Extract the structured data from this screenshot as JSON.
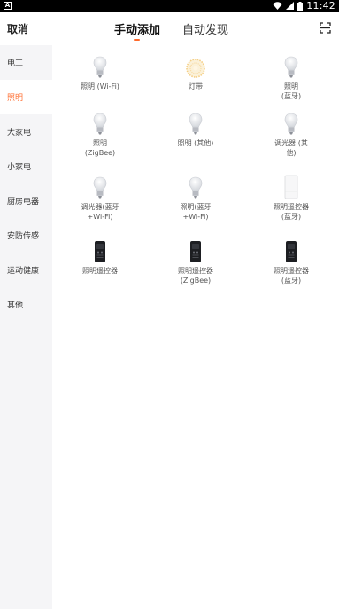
{
  "status": {
    "time": "11:42"
  },
  "header": {
    "cancel": "取消",
    "tabs": [
      {
        "label": "手动添加",
        "active": true
      },
      {
        "label": "自动发现",
        "active": false
      }
    ]
  },
  "sidebar": {
    "items": [
      {
        "label": "电工",
        "active": false
      },
      {
        "label": "照明",
        "active": true
      },
      {
        "label": "大家电",
        "active": false
      },
      {
        "label": "小家电",
        "active": false
      },
      {
        "label": "厨房电器",
        "active": false
      },
      {
        "label": "安防传感",
        "active": false
      },
      {
        "label": "运动健康",
        "active": false
      },
      {
        "label": "其他",
        "active": false
      }
    ]
  },
  "devices": [
    {
      "label": "照明 (Wi-Fi)",
      "icon": "bulb-icon"
    },
    {
      "label": "灯带",
      "icon": "light-strip-icon"
    },
    {
      "label": "照明\n(蓝牙)",
      "icon": "bulb-icon"
    },
    {
      "label": "照明\n(ZigBee)",
      "icon": "bulb-icon"
    },
    {
      "label": "照明 (其他)",
      "icon": "bulb-icon"
    },
    {
      "label": "调光器 (其\n他)",
      "icon": "bulb-icon"
    },
    {
      "label": "调光器(蓝牙\n+Wi-Fi)",
      "icon": "bulb-icon"
    },
    {
      "label": "照明(蓝牙\n+Wi-Fi)",
      "icon": "bulb-icon"
    },
    {
      "label": "照明遥控器\n(蓝牙)",
      "icon": "wall-panel-icon"
    },
    {
      "label": "照明遥控器",
      "icon": "remote-icon"
    },
    {
      "label": "照明遥控器\n(ZigBee)",
      "icon": "remote-icon"
    },
    {
      "label": "照明遥控器\n(蓝牙)",
      "icon": "remote-icon"
    }
  ],
  "colors": {
    "accent": "#ff6a2b",
    "sidebar_bg": "#f5f5f7"
  }
}
